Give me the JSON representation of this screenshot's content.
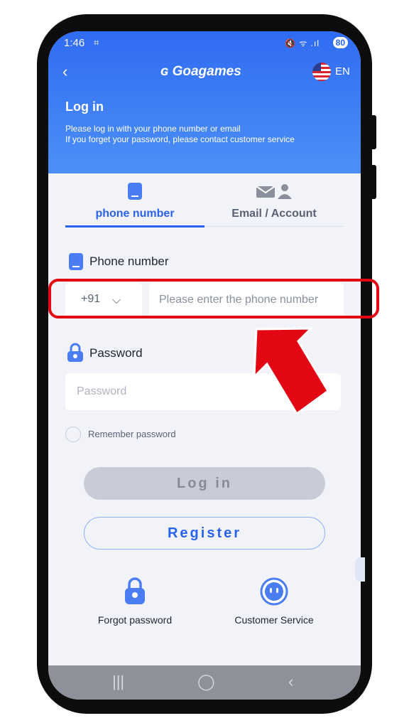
{
  "status_bar": {
    "time": "1:46",
    "battery": "80"
  },
  "header": {
    "brand": "Goagames",
    "language": "EN",
    "title": "Log in",
    "subtitle_line1": "Please log in with your phone number or email",
    "subtitle_line2": "If you forget your password, please contact customer service"
  },
  "tabs": [
    {
      "label": "phone number",
      "icon": "phone-icon",
      "active": true
    },
    {
      "label": "Email / Account",
      "icon": "email-account-icon",
      "active": false
    }
  ],
  "phone_section": {
    "label": "Phone number",
    "country_code": "+91",
    "placeholder": "Please enter the phone number"
  },
  "password_section": {
    "label": "Password",
    "placeholder": "Password"
  },
  "remember_label": "Remember password",
  "buttons": {
    "login": "Log in",
    "register": "Register"
  },
  "bottom_links": {
    "forgot": "Forgot password",
    "customer_service": "Customer Service"
  },
  "colors": {
    "accent": "#2a62f0",
    "annotation": "#e30613"
  }
}
